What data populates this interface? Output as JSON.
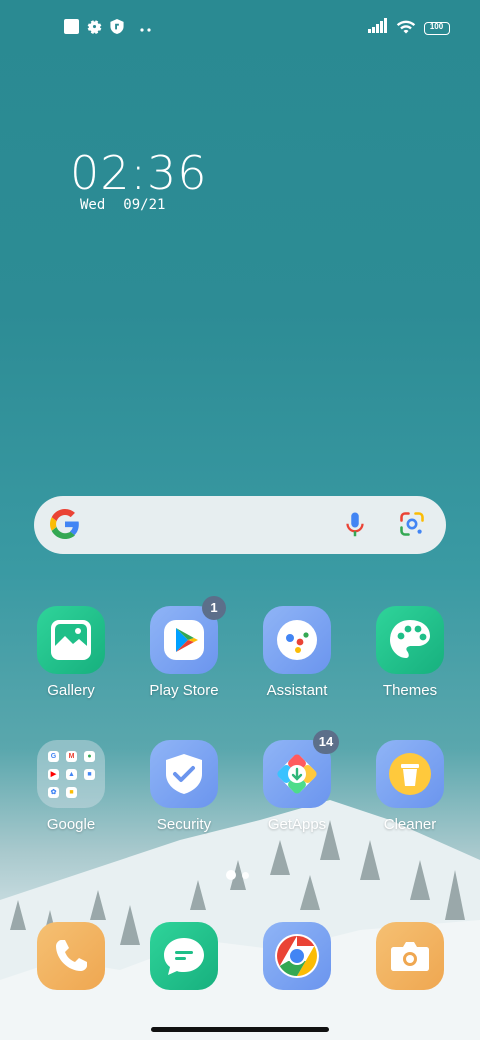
{
  "status_bar": {
    "left_icons": [
      "square-icon",
      "gear-icon",
      "shield-icon",
      "more-dots-icon"
    ],
    "right_icons": [
      "signal-icon",
      "wifi-icon",
      "battery-icon"
    ],
    "battery": "100"
  },
  "clock": {
    "time": "02:36",
    "day": "Wed",
    "date": "09/21"
  },
  "search_bar": {
    "icons": [
      "google-g-icon",
      "microphone-icon",
      "google-lens-icon"
    ]
  },
  "apps_row1": [
    {
      "label": "Gallery",
      "icon": "gallery-icon"
    },
    {
      "label": "Play Store",
      "icon": "play-store-icon",
      "badge": "1"
    },
    {
      "label": "Assistant",
      "icon": "assistant-icon"
    },
    {
      "label": "Themes",
      "icon": "palette-icon"
    }
  ],
  "apps_row2": [
    {
      "label": "Google",
      "icon": "folder-icon"
    },
    {
      "label": "Security",
      "icon": "shield-check-icon"
    },
    {
      "label": "GetApps",
      "icon": "getapps-icon",
      "badge": "14"
    },
    {
      "label": "Cleaner",
      "icon": "trash-icon"
    }
  ],
  "page_indicator": {
    "pages": 2,
    "current": 1
  },
  "dock": [
    {
      "icon": "phone-icon"
    },
    {
      "icon": "messages-icon"
    },
    {
      "icon": "chrome-icon"
    },
    {
      "icon": "camera-icon"
    }
  ],
  "colors": {
    "wallpaper": "#2d8c95",
    "badge": "#5c6f8a"
  }
}
